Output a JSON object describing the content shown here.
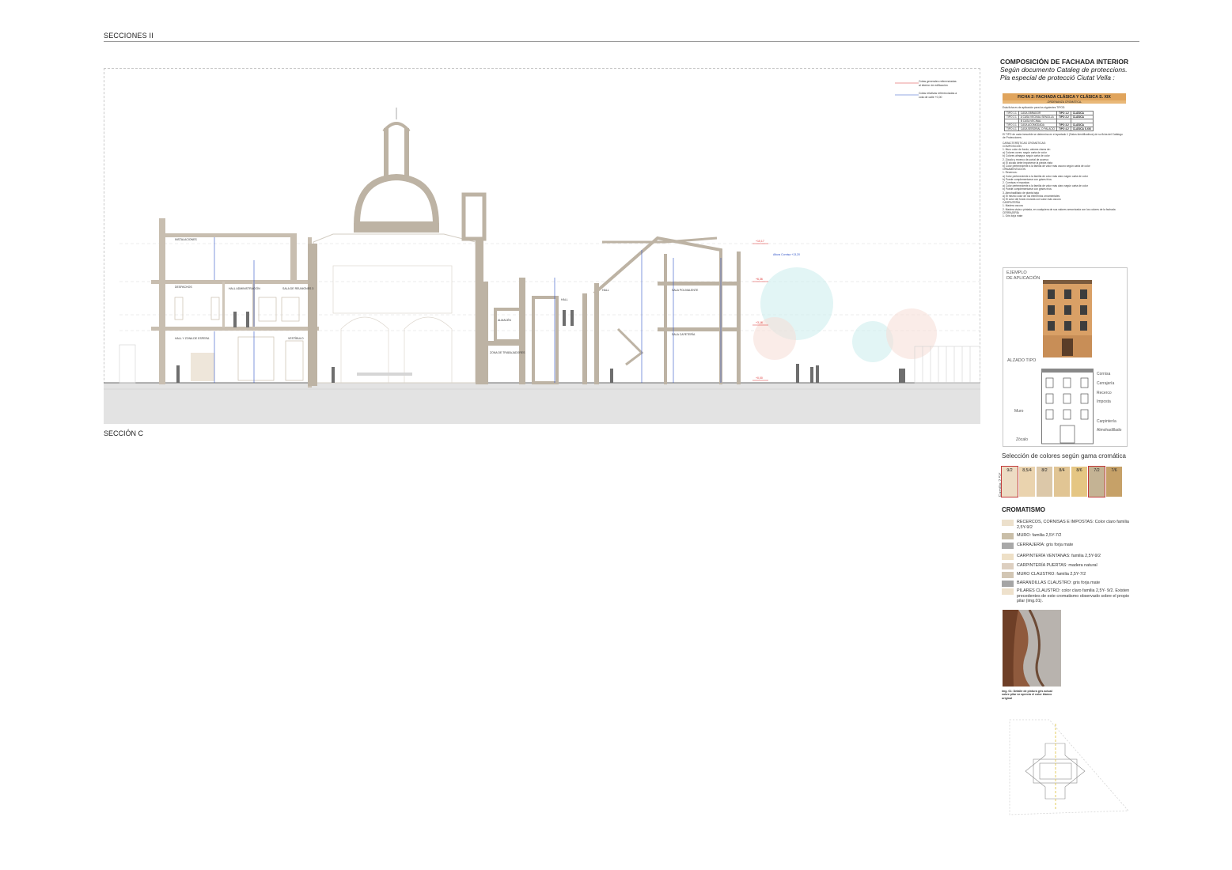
{
  "sheet": {
    "title": "SECCIONES II",
    "section_label": "SECCIÓN C"
  },
  "legend": {
    "general": "Cotas generales referenciadas al interior de edificación",
    "relative": "Cotas relativas referenciadas a cota de calle +0,00",
    "general_value": "+X,XX",
    "relative_value": "+X,XX"
  },
  "drawing": {
    "rooms": [
      "INSTALACIONES",
      "DESPACHOS",
      "HALL ADMINISTRACIÓN",
      "SALA DE REUNIONES 3",
      "HALL Y ZONA DE ESPERA",
      "VESTÍBULO",
      "ALMACÉN",
      "ZONA DE TRABAJADORES",
      "HALL",
      "HALL",
      "SALA POLIVALENTE",
      "SALA CAFETERÍA"
    ],
    "levels": [
      "+10,17",
      "+6,36",
      "+6,16",
      "+3,16",
      "+3,15",
      "+0,16",
      "+0,25",
      "+0,00",
      "+0,25",
      "+0,00"
    ],
    "street_label": "Altura Cornisa +13,20"
  },
  "panel": {
    "title": "COMPOSICIÓN DE FACHADA INTERIOR",
    "subtitle_1": "Según documento Cataleg de proteccions.",
    "subtitle_2": "Pla especial de protecció Ciutat Vella :"
  },
  "ficha": {
    "head": "FICHA 2: FACHADA CLÁSICA Y CLÁSICA S. XIX",
    "sub": "-ORDENANZA CROMÁTICA-",
    "intro": "Esta ficha es de aplicación para los siguientes TIPOS:",
    "rows": [
      [
        "TIPO 1.1",
        "CASA OBRADOR",
        "TIPO 1.2",
        "CLÁSICA"
      ],
      [
        "TIPO 2.1",
        "A CASA VECINAL SENCILLA",
        "TIPO 2.2",
        "CLÁSICA"
      ],
      [
        "",
        "B CASA VECINAL",
        "",
        ""
      ],
      [
        "TIPO 3.1",
        "CASA ACOMODADA",
        "TIPO 3.2",
        "CLÁSICA"
      ],
      [
        "TIPO 4.1",
        "CASA SEÑORIAL O PALACIO",
        "TIPO 4.2",
        "CLÁSICA S.XIX"
      ]
    ],
    "note": "El TIPO de cada inmueble se determina en el apartado 1 (Datos identificativos) de su ficha del Catálogo de Protecciones.",
    "lines": [
      "CARACTERÍSTICAS CROMÁTICAS:",
      "COMPOSICIÓN",
      "1. Muro color de fondo, valores claros de:",
      "a) Colores ocres: según carta de color",
      "b) Colores almagra: según carta de color",
      "2. Zócalo y recerco de portal de acceso:",
      "a) El zócalo debe imponerse la piedra vista",
      "b) Color perteneciente a la familia de valor más oscuro según carta de color",
      "ORNAMENTACIÓN",
      "1. Recercos:",
      "a) Color perteneciente a la familia de color más claro según carta de color",
      "b) Puede complementarse con grises fríos",
      "2. Cornisas e impostas:",
      "a) Color perteneciente a la familia de valor más claro según carta de color",
      "b) Puede complementarse con grises fríos",
      "3. Almohadillado de planta baja",
      "a) El mismo color de los elementos ornamentales",
      "b) El color del fondo muraria con valor más oscuro",
      "CARPINTERÍA",
      "1. Madera oscura",
      "2. Madera vista o pintada, en cualquiera de sus valores armonizada con los colores de la fachada",
      "CERRAJERÍA",
      "1. Gris forja mate"
    ]
  },
  "example": {
    "title_1": "EJEMPLO",
    "title_2": "DE APLICACIÓN",
    "alzado": "ALZADO TIPO",
    "labels": [
      "Cornisa",
      "Cerrajería",
      "Recerco",
      "Imposta",
      "Muro",
      "Carpintería",
      "Almohadillado",
      "Zócalo"
    ]
  },
  "selection": {
    "title": "Selección de colores según gama cromática",
    "family_label": "Familia 2,5Y",
    "swatches": [
      {
        "label": "9/2",
        "color": "#eddcc4",
        "selected": true
      },
      {
        "label": "8,5/4",
        "color": "#ead3ae",
        "selected": false
      },
      {
        "label": "8/2",
        "color": "#dcc8a9",
        "selected": false
      },
      {
        "label": "8/4",
        "color": "#e1c594",
        "selected": false
      },
      {
        "label": "8/6",
        "color": "#e5c683",
        "selected": false
      },
      {
        "label": "7/2",
        "color": "#c4b394",
        "selected": true
      },
      {
        "label": "7/6",
        "color": "#c6a168",
        "selected": false
      }
    ]
  },
  "cromatismo": {
    "title": "CROMATISMO",
    "items": [
      {
        "label": "RECERCOS, CORNISAS E IMPOSTAS:",
        "value": "Color claro familia 2,5Y-9/2",
        "color": "#ece0cc"
      },
      {
        "label": "MURO:",
        "value": "familia 2,5Y-7/2",
        "color": "#c9bea8"
      },
      {
        "label": "CERRAJERÍA:",
        "value": "gris forja mate",
        "color": "#a8a8a8"
      },
      {
        "label": "CARPINTERÍA VENTANAS:",
        "value": "familia 2,5Y-9/2",
        "color": "#eee0c7"
      },
      {
        "label": "CARPINTERÍA PUERTAS:",
        "value": "madera natural",
        "color": "#ddcfc0"
      },
      {
        "label": "MURO CLAUSTRO:",
        "value": "familia 2,5Y-7/2",
        "color": "#d2c6b4"
      },
      {
        "label": "BARANDILLAS CLAUSTRO:",
        "value": "gris forja mate",
        "color": "#a5a5a5"
      },
      {
        "label": "PILARES CLAUSTRO:",
        "value": "color claro familia 2,5Y- 9/2. Existen precedentes de este cromatismo observado sobre el propio pilar (img.01).",
        "color": "#eee1cc"
      }
    ]
  },
  "photo": {
    "caption": "img. 01: Detalle de pintura gris actual sobre pilar se aprecia el color blanco original"
  }
}
